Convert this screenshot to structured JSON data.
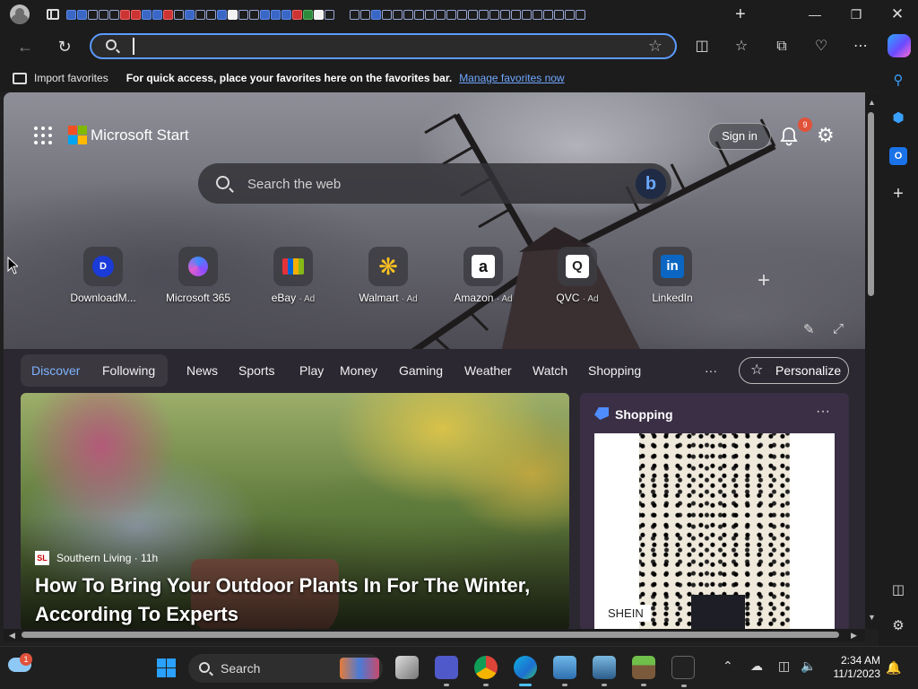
{
  "browser": {
    "address_placeholder": "",
    "favorites": {
      "import_label": "Import favorites",
      "tip_text": "For quick access, place your favorites here on the favorites bar.",
      "manage_link": "Manage favorites now"
    }
  },
  "msn": {
    "brand": "Microsoft Start",
    "signin_label": "Sign in",
    "notification_count": "9",
    "search_placeholder": "Search the web",
    "quick_links": [
      {
        "label": "DownloadM...",
        "ad": ""
      },
      {
        "label": "Microsoft 365",
        "ad": ""
      },
      {
        "label": "eBay",
        "ad": "· Ad"
      },
      {
        "label": "Walmart",
        "ad": "· Ad"
      },
      {
        "label": "Amazon",
        "ad": "· Ad"
      },
      {
        "label": "QVC",
        "ad": "· Ad"
      },
      {
        "label": "LinkedIn",
        "ad": ""
      }
    ],
    "feed_tabs": {
      "discover": "Discover",
      "following": "Following",
      "news": "News",
      "sports": "Sports",
      "play": "Play",
      "money": "Money",
      "gaming": "Gaming",
      "weather": "Weather",
      "watch": "Watch",
      "shopping": "Shopping",
      "more": "···"
    },
    "personalize_label": "Personalize",
    "main_article": {
      "source": "Southern Living · 11h",
      "source_logo": "SL",
      "headline": "How To Bring Your Outdoor Plants In For The Winter, According To Experts"
    },
    "shopping_card": {
      "title": "Shopping",
      "more": "···",
      "brand": "SHEIN"
    }
  },
  "taskbar": {
    "weather_badge": "1",
    "search_label": "Search",
    "time": "2:34 AM",
    "date": "11/1/2023"
  },
  "colors": {
    "accent": "#5b9bff",
    "active_tab": "#7db4ff",
    "badge": "#e0523a"
  }
}
